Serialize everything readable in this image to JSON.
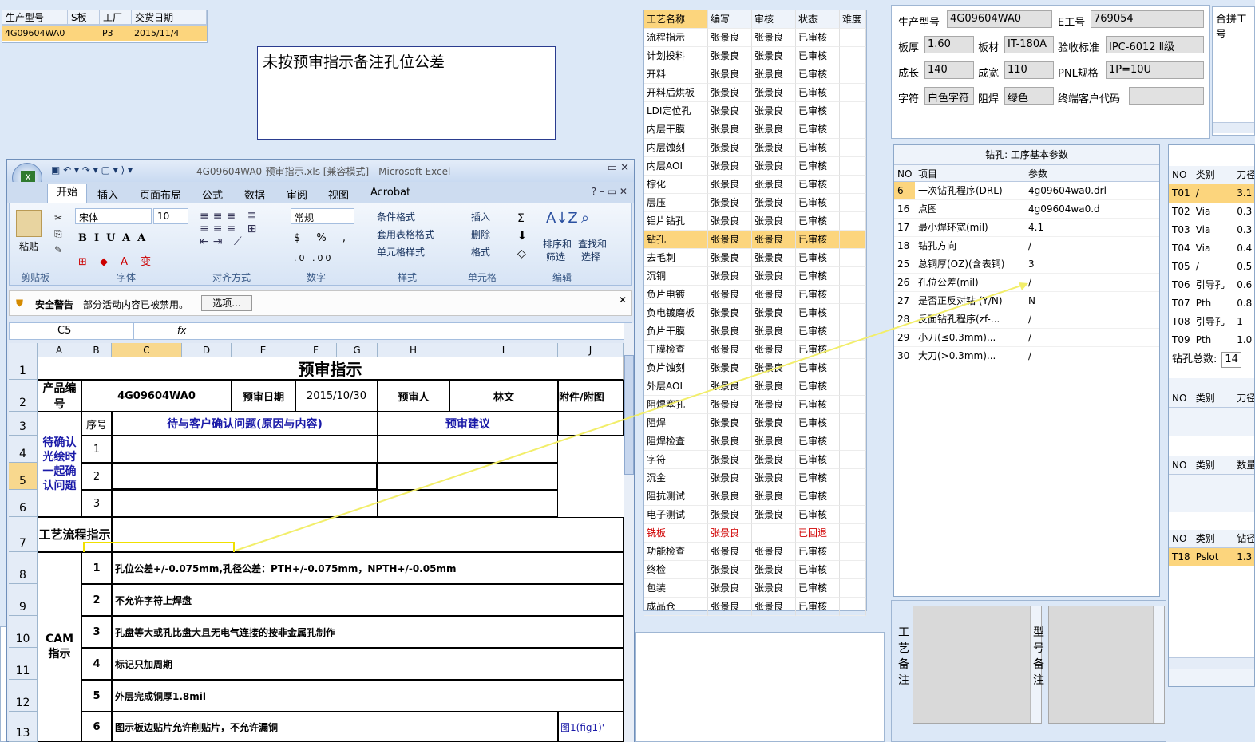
{
  "top_grid": {
    "headers": [
      "生产型号",
      "S板",
      "工厂",
      "交货日期"
    ],
    "row": [
      "4G09604WA0",
      "",
      "P3",
      "2015/11/4"
    ]
  },
  "note_text": "未按预审指示备注孔位公差",
  "excel": {
    "title": "4G09604WA0-预审指示.xls  [兼容模式] - Microsoft Excel",
    "tabs": [
      "开始",
      "插入",
      "页面布局",
      "公式",
      "数据",
      "审阅",
      "视图",
      "Acrobat"
    ],
    "font_name": "宋体",
    "font_size": "10",
    "number_format": "常规",
    "groups": [
      "剪贴板",
      "字体",
      "对齐方式",
      "数字",
      "样式",
      "单元格",
      "编辑"
    ],
    "paste_label": "粘贴",
    "style_items": [
      "条件格式",
      "套用表格格式",
      "单元格样式"
    ],
    "cell_items": [
      "插入",
      "删除",
      "格式"
    ],
    "edit_items": [
      "排序和筛选",
      "查找和选择"
    ],
    "sort_l1": "排序和",
    "sort_l2": "筛选",
    "find_l1": "查找和",
    "find_l2": "选择",
    "security_title": "安全警告",
    "security_msg": "部分活动内容已被禁用。",
    "options_btn": "选项...",
    "name_box": "C5",
    "fx": "fx",
    "cols": [
      "A",
      "B",
      "C",
      "D",
      "E",
      "F",
      "G",
      "H",
      "I",
      "J"
    ],
    "rows": [
      "1",
      "2",
      "3",
      "4",
      "5",
      "6",
      "7",
      "8",
      "9",
      "10",
      "11",
      "12",
      "13"
    ],
    "sheet_title": "预审指示",
    "product_label": "产品编号",
    "product_no": "4G09604WA0",
    "pre_date_label": "预审日期",
    "pre_date": "2015/10/30",
    "reviewer_label": "预审人",
    "reviewer": "林文",
    "attach_label": "附件/附图",
    "seq_label": "序号",
    "issue_label": "待与客户确认问题(原因与内容)",
    "suggest_label": "预审建议",
    "pending_label": "待确认光绘时一起确认问题",
    "seq_nums": [
      "1",
      "2",
      "3"
    ],
    "flow_label": "工艺流程指示",
    "cam_label": "CAM指示",
    "cam_items": [
      {
        "n": "1",
        "t": "孔位公差+/-0.075mm,孔径公差：PTH+/-0.075mm，NPTH+/-0.05mm"
      },
      {
        "n": "2",
        "t": "不允许字符上焊盘"
      },
      {
        "n": "3",
        "t": "孔盘等大或孔比盘大且无电气连接的按非金属孔制作"
      },
      {
        "n": "4",
        "t": "标记只加周期"
      },
      {
        "n": "5",
        "t": "外层完成铜厚1.8mil"
      },
      {
        "n": "6",
        "t": "图示板边贴片允许削贴片，不允许漏铜"
      }
    ],
    "fig_link": "图1(fig1)'"
  },
  "process": {
    "headers": [
      "工艺名称",
      "编写",
      "审核",
      "状态",
      "难度"
    ],
    "rows": [
      [
        "流程指示",
        "张景良",
        "张景良",
        "已审核"
      ],
      [
        "计划投料",
        "张景良",
        "张景良",
        "已审核"
      ],
      [
        "开料",
        "张景良",
        "张景良",
        "已审核"
      ],
      [
        "开料后烘板",
        "张景良",
        "张景良",
        "已审核"
      ],
      [
        "LDI定位孔",
        "张景良",
        "张景良",
        "已审核"
      ],
      [
        "内层干膜",
        "张景良",
        "张景良",
        "已审核"
      ],
      [
        "内层蚀刻",
        "张景良",
        "张景良",
        "已审核"
      ],
      [
        "内层AOI",
        "张景良",
        "张景良",
        "已审核"
      ],
      [
        "棕化",
        "张景良",
        "张景良",
        "已审核"
      ],
      [
        "层压",
        "张景良",
        "张景良",
        "已审核"
      ],
      [
        "铝片钻孔",
        "张景良",
        "张景良",
        "已审核"
      ],
      [
        "钻孔",
        "张景良",
        "张景良",
        "已审核"
      ],
      [
        "去毛刺",
        "张景良",
        "张景良",
        "已审核"
      ],
      [
        "沉铜",
        "张景良",
        "张景良",
        "已审核"
      ],
      [
        "负片电镀",
        "张景良",
        "张景良",
        "已审核"
      ],
      [
        "负电镀磨板",
        "张景良",
        "张景良",
        "已审核"
      ],
      [
        "负片干膜",
        "张景良",
        "张景良",
        "已审核"
      ],
      [
        "干膜检查",
        "张景良",
        "张景良",
        "已审核"
      ],
      [
        "负片蚀刻",
        "张景良",
        "张景良",
        "已审核"
      ],
      [
        "外层AOI",
        "张景良",
        "张景良",
        "已审核"
      ],
      [
        "阻焊塞孔",
        "张景良",
        "张景良",
        "已审核"
      ],
      [
        "阻焊",
        "张景良",
        "张景良",
        "已审核"
      ],
      [
        "阻焊检查",
        "张景良",
        "张景良",
        "已审核"
      ],
      [
        "字符",
        "张景良",
        "张景良",
        "已审核"
      ],
      [
        "沉金",
        "张景良",
        "张景良",
        "已审核"
      ],
      [
        "阻抗测试",
        "张景良",
        "张景良",
        "已审核"
      ],
      [
        "电子测试",
        "张景良",
        "张景良",
        "已审核"
      ],
      [
        "铣板",
        "张景良",
        "",
        "已回退"
      ],
      [
        "功能检查",
        "张景良",
        "张景良",
        "已审核"
      ],
      [
        "终检",
        "张景良",
        "张景良",
        "已审核"
      ],
      [
        "包装",
        "张景良",
        "张景良",
        "已审核"
      ],
      [
        "成品仓",
        "张景良",
        "张景良",
        "已审核"
      ]
    ],
    "selected_index": 11,
    "returned_index": 27
  },
  "info": {
    "model_label": "生产型号",
    "model": "4G09604WA0",
    "eng_label": "E工号",
    "eng": "769054",
    "combine_label": "合拼工号",
    "thick_label": "板厚",
    "thick": "1.60",
    "mat_label": "板材",
    "mat": "IT-180A",
    "std_label": "验收标准",
    "std": "IPC-6012 Ⅱ级",
    "len_label": "成长",
    "len": "140",
    "wid_label": "成宽",
    "wid": "110",
    "pnl_label": "PNL规格",
    "pnl": "1P=10U",
    "char_label": "字符",
    "char": "白色字符",
    "mask_label": "阻焊",
    "mask": "绿色",
    "cust_label": "终端客户代码",
    "cust": ""
  },
  "drill": {
    "title": "钻孔: 工序基本参数",
    "headers": [
      "NO",
      "项目",
      "参数"
    ],
    "rows": [
      [
        "6",
        "一次钻孔程序(DRL)",
        "4g09604wa0.drl"
      ],
      [
        "16",
        "点图",
        "4g09604wa0.d"
      ],
      [
        "17",
        "最小焊环宽(mil)",
        "4.1"
      ],
      [
        "18",
        "钻孔方向",
        "/"
      ],
      [
        "25",
        "总铜厚(OZ)(含表铜)",
        "3"
      ],
      [
        "26",
        "孔位公差(mil)",
        "/"
      ],
      [
        "27",
        "是否正反对钻 (Y/N)",
        "N"
      ],
      [
        "28",
        "反面钻孔程序(zf-...",
        "/"
      ],
      [
        "29",
        "小刀(≤0.3mm)...",
        "/"
      ],
      [
        "30",
        "大刀(>0.3mm)...",
        "/"
      ]
    ]
  },
  "tools": {
    "headers": [
      "NO",
      "类别",
      "刀径"
    ],
    "rows": [
      [
        "T01",
        "/",
        "3.1"
      ],
      [
        "T02",
        "Via",
        "0.3"
      ],
      [
        "T03",
        "Via",
        "0.3"
      ],
      [
        "T04",
        "Via",
        "0.4"
      ],
      [
        "T05",
        "/",
        "0.5"
      ],
      [
        "T06",
        "引导孔",
        "0.6"
      ],
      [
        "T07",
        "Pth",
        "0.8"
      ],
      [
        "T08",
        "引导孔",
        "1"
      ],
      [
        "T09",
        "Pth",
        "1.0"
      ]
    ],
    "total_label": "钻孔总数:",
    "total": "14",
    "h2": [
      "NO",
      "类别",
      "刀径"
    ],
    "h3": [
      "NO",
      "类别",
      "数量"
    ],
    "h4": [
      "NO",
      "类别",
      "钻径"
    ],
    "slot_row": [
      "T18",
      "Pslot",
      "1.3"
    ]
  },
  "remarks": {
    "proc_label": "工艺备注",
    "model_label": "型号备注"
  }
}
